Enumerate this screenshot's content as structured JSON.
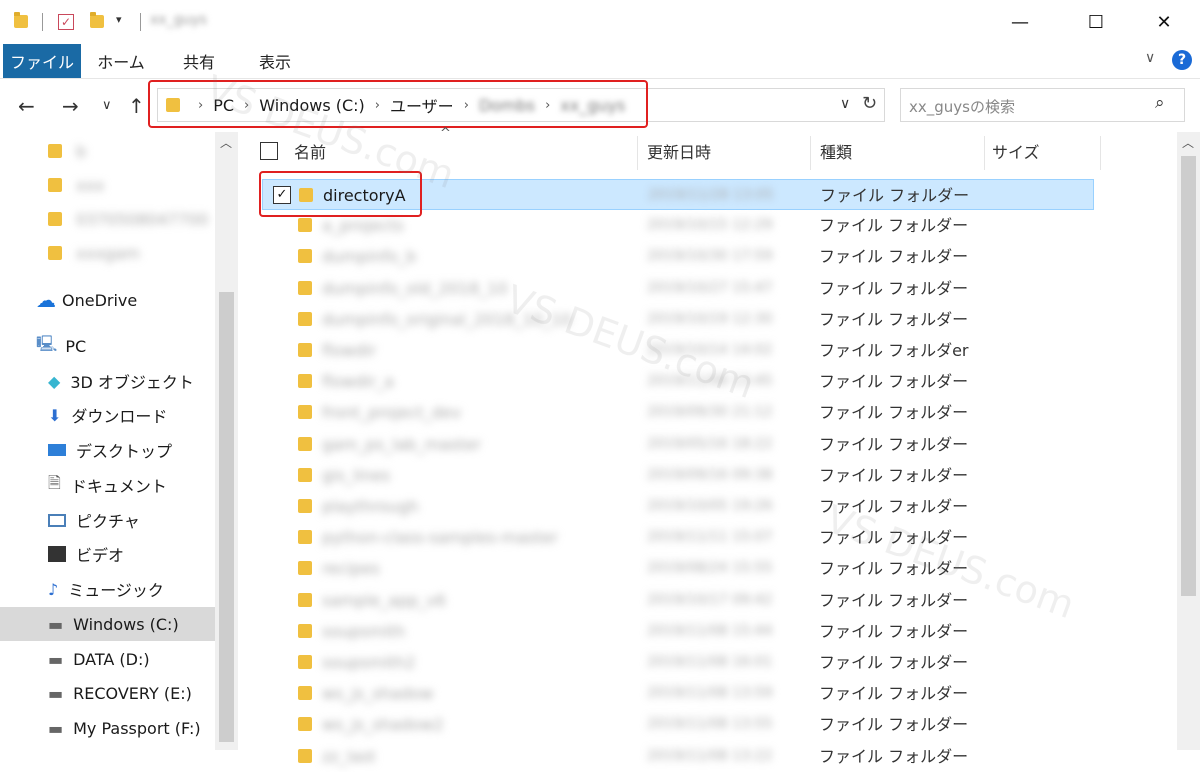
{
  "titlebar": {
    "window_title": "xx_guys"
  },
  "ribbon": {
    "tabs": [
      "ファイル",
      "ホーム",
      "共有",
      "表示"
    ]
  },
  "address": {
    "crumbs": [
      "PC",
      "Windows (C:)",
      "ユーザー",
      "Dombs",
      "xx_guys"
    ]
  },
  "search": {
    "placeholder": "xx_guysの検索"
  },
  "tree": {
    "quick": [
      "b",
      "xxx",
      "0370508047700",
      "xxxgam"
    ],
    "onedrive": "OneDrive",
    "pc": "PC",
    "pc_items": [
      "3D オブジェクト",
      "ダウンロード",
      "デスクトップ",
      "ドキュメント",
      "ピクチャ",
      "ビデオ",
      "ミュージック",
      "Windows (C:)",
      "DATA (D:)",
      "RECOVERY (E:)",
      "My Passport (F:)"
    ]
  },
  "list": {
    "columns": [
      "名前",
      "更新日時",
      "種類",
      "サイズ"
    ],
    "rows": [
      {
        "name": "directoryA",
        "date": "2019/11/28 13:05",
        "type": "ファイル フォルダー"
      },
      {
        "name": "a_projects",
        "date": "2019/10/15 12:29",
        "type": "ファイル フォルダー"
      },
      {
        "name": "dumpinfo_b",
        "date": "2019/10/30 17:59",
        "type": "ファイル フォルダー"
      },
      {
        "name": "dumpinfo_old_2018_10",
        "date": "2019/10/27 15:47",
        "type": "ファイル フォルダー"
      },
      {
        "name": "dumpinfo_original_2018_10_10",
        "date": "2019/10/19 12:30",
        "type": "ファイル フォルダー"
      },
      {
        "name": "flowdir",
        "date": "2019/10/14 14:02",
        "type": "ファイル フォルダer"
      },
      {
        "name": "flowdir_a",
        "date": "2019/11/08 13:45",
        "type": "ファイル フォルダー"
      },
      {
        "name": "front_project_dev",
        "date": "2019/09/30 21:12",
        "type": "ファイル フォルダー"
      },
      {
        "name": "gam_ps_lab_master",
        "date": "2019/05/16 18:22",
        "type": "ファイル フォルダー"
      },
      {
        "name": "gis_lines",
        "date": "2019/09/16 09:38",
        "type": "ファイル フォルダー"
      },
      {
        "name": "playthrough",
        "date": "2019/10/05 19:26",
        "type": "ファイル フォルダー"
      },
      {
        "name": "python-class-samples-master",
        "date": "2019/11/11 15:07",
        "type": "ファイル フォルダー"
      },
      {
        "name": "recipes",
        "date": "2019/08/24 15:55",
        "type": "ファイル フォルダー"
      },
      {
        "name": "sample_app_v6",
        "date": "2019/10/17 09:42",
        "type": "ファイル フォルダー"
      },
      {
        "name": "soupsmith",
        "date": "2019/11/08 15:44",
        "type": "ファイル フォルダー"
      },
      {
        "name": "soupsmith2",
        "date": "2019/11/08 16:01",
        "type": "ファイル フォルダー"
      },
      {
        "name": "ws_js_shadow",
        "date": "2019/11/08 13:59",
        "type": "ファイル フォルダー"
      },
      {
        "name": "ws_js_shadow2",
        "date": "2019/11/08 13:55",
        "type": "ファイル フォルダー"
      },
      {
        "name": "zz_last",
        "date": "2019/11/08 13:22",
        "type": "ファイル フォルダー"
      }
    ]
  },
  "watermark": "VS DEUS.com"
}
